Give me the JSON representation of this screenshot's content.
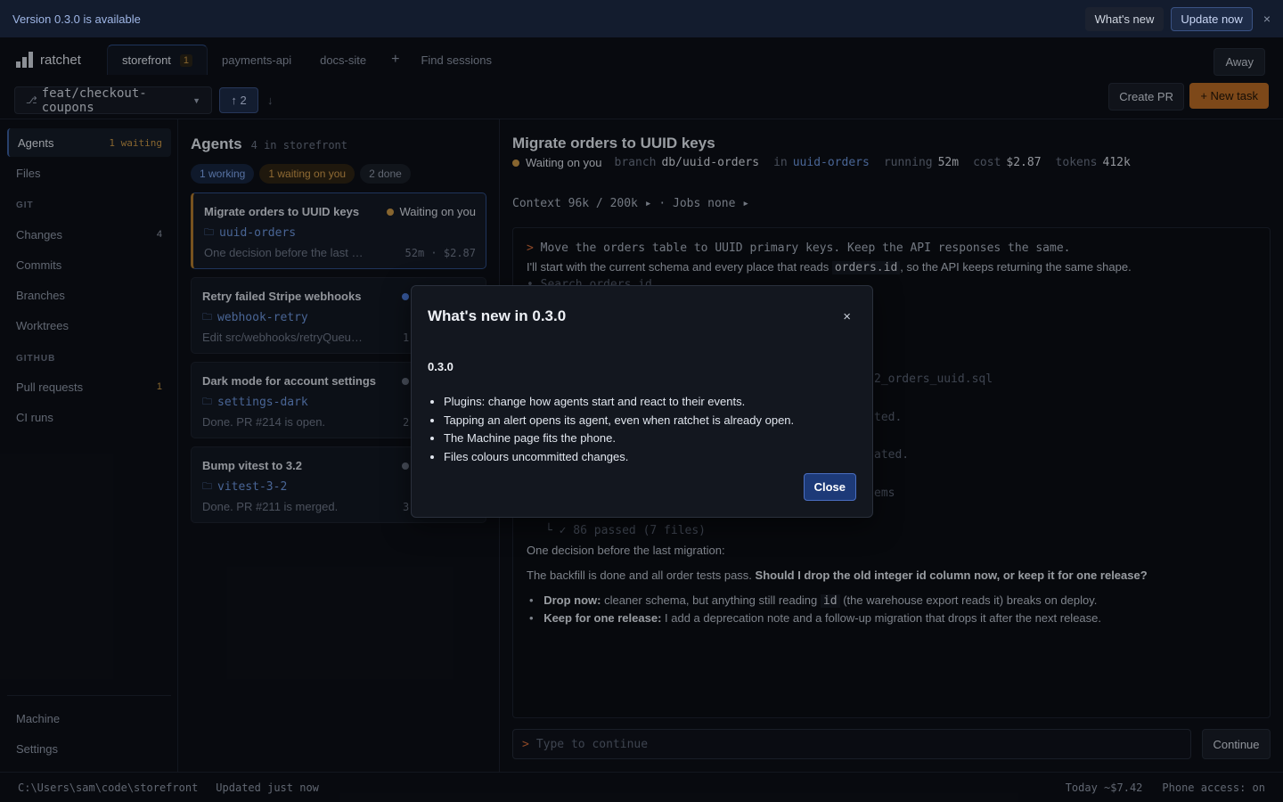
{
  "banner": {
    "text": "Version 0.3.0 is available",
    "whats_new": "What's new",
    "update_now": "Update now",
    "close": "×"
  },
  "app": {
    "name": "ratchet"
  },
  "tabs": [
    {
      "label": "storefront",
      "badge": "1"
    },
    {
      "label": "payments-api"
    },
    {
      "label": "docs-site"
    }
  ],
  "tab_add": "+",
  "find_sessions": "Find sessions",
  "away": "Away",
  "branch": {
    "name": "feat/checkout-coupons",
    "ahead": "↑ 2",
    "behind": "↓",
    "create_pr": "Create PR",
    "new_task": "+ New task"
  },
  "sidebar": {
    "agents": {
      "label": "Agents",
      "status": "1 waiting"
    },
    "files": "Files",
    "git_section": "GIT",
    "changes": {
      "label": "Changes",
      "count": "4"
    },
    "commits": "Commits",
    "branches": "Branches",
    "worktrees": "Worktrees",
    "github_section": "GITHUB",
    "pull_requests": {
      "label": "Pull requests",
      "count": "1"
    },
    "ci_runs": "CI runs",
    "machine": "Machine",
    "settings": "Settings"
  },
  "agents": {
    "title": "Agents",
    "subtitle": "4 in storefront",
    "filters": [
      "1 working",
      "1 waiting on you",
      "2 done"
    ],
    "cards": [
      {
        "title": "Migrate orders to UUID keys",
        "status": "Waiting on you",
        "branch": "uuid-orders",
        "message": "One decision before the last migration:",
        "meta": "52m · $2.87"
      },
      {
        "title": "Retry failed Stripe webhooks",
        "branch": "webhook-retry",
        "message": "Edit src/webhooks/retryQueue.ts",
        "meta": "1"
      },
      {
        "title": "Dark mode for account settings",
        "branch": "settings-dark",
        "message": "Done. PR #214 is open.",
        "meta": "2"
      },
      {
        "title": "Bump vitest to 3.2",
        "branch": "vitest-3-2",
        "message": "Done. PR #211 is merged.",
        "meta": "3"
      }
    ]
  },
  "detail": {
    "title": "Migrate orders to UUID keys",
    "status": "Waiting on you",
    "branch_label": "branch",
    "branch": "db/uuid-orders",
    "in_label": "in",
    "worktree": "uuid-orders",
    "running_label": "running",
    "running": "52m",
    "cost_label": "cost",
    "cost": "$2.87",
    "tokens_label": "tokens",
    "tokens": "412k",
    "context": "Context 96k / 200k ▸ · Jobs none ▸",
    "log": {
      "prompt": ">",
      "command": "Move the orders table to UUID primary keys. Keep the API responses the same.",
      "intro_a": "I'll start with the current schema and every place that reads",
      "intro_code": "orders.id",
      "intro_b": ", so the API keeps returning the same shape.",
      "search": "• Search orders.id",
      "file_tail": "2_orders_uuid.sql",
      "tail_1": "ted.",
      "tail_2": "ated.",
      "tail_3": "ems",
      "passed": "└ ✓ 86 passed (7 files)",
      "decision": "One decision before the last migration:",
      "backfill_a": "The backfill is done and all order tests pass.",
      "backfill_b": "Should I drop the old integer id column now, or keep it for one release?",
      "opt1_bold": "Drop now:",
      "opt1_a": "cleaner schema, but anything still reading",
      "opt1_code": "id",
      "opt1_b": "(the warehouse export reads it) breaks on deploy.",
      "opt2_bold": "Keep for one release:",
      "opt2_text": "I add a deprecation note and a follow-up migration that drops it after the next release."
    },
    "input_prompt": ">",
    "input_placeholder": "Type to continue",
    "continue": "Continue"
  },
  "statusbar": {
    "path": "C:\\Users\\sam\\code\\storefront",
    "updated": "Updated just now",
    "today": "Today ~$7.42",
    "phone": "Phone access: on"
  },
  "modal": {
    "title": "What's new in 0.3.0",
    "close_icon": "×",
    "version": "0.3.0",
    "items": [
      "Plugins: change how agents start and react to their events.",
      "Tapping an alert opens its agent, even when ratchet is already open.",
      "The Machine page fits the phone.",
      "Files colours uncommitted changes."
    ],
    "close": "Close"
  },
  "colors": {
    "accent": "#3b5f9e",
    "waiting": "#c79646",
    "working": "#4f7fe0",
    "done": "#6b7485",
    "new_task": "#b86a25"
  }
}
